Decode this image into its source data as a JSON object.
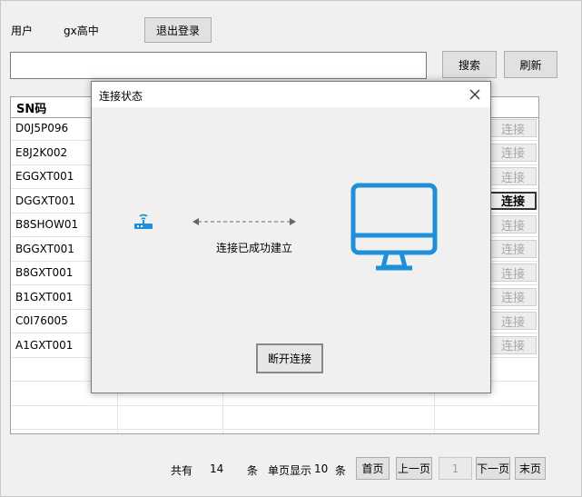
{
  "header": {
    "user_label": "用户",
    "user_name": "gx高中",
    "logout_label": "退出登录"
  },
  "search": {
    "value": "",
    "search_label": "搜索",
    "refresh_label": "刷新"
  },
  "table": {
    "col_sn": "SN码",
    "connect_label": "连接",
    "rows": [
      {
        "sn": "D0J5P096"
      },
      {
        "sn": "E8J2K002"
      },
      {
        "sn": "EGGXT001"
      },
      {
        "sn": "DGGXT001"
      },
      {
        "sn": "B8SHOW01"
      },
      {
        "sn": "BGGXT001"
      },
      {
        "sn": "B8GXT001"
      },
      {
        "sn": "B1GXT001"
      },
      {
        "sn": "C0I76005"
      },
      {
        "sn": "A1GXT001"
      }
    ]
  },
  "pagination": {
    "total_prefix": "共有",
    "total": "14",
    "total_unit": "条",
    "per_page_prefix": "单页显示",
    "per_page": "10",
    "per_page_unit": "条",
    "first": "首页",
    "prev": "上一页",
    "current_page": "1",
    "next": "下一页",
    "last": "末页"
  },
  "dialog": {
    "title": "连接状态",
    "status_text": "连接已成功建立",
    "disconnect_label": "断开连接",
    "close_icon": "close-icon",
    "accent": "#1e8fd8"
  }
}
